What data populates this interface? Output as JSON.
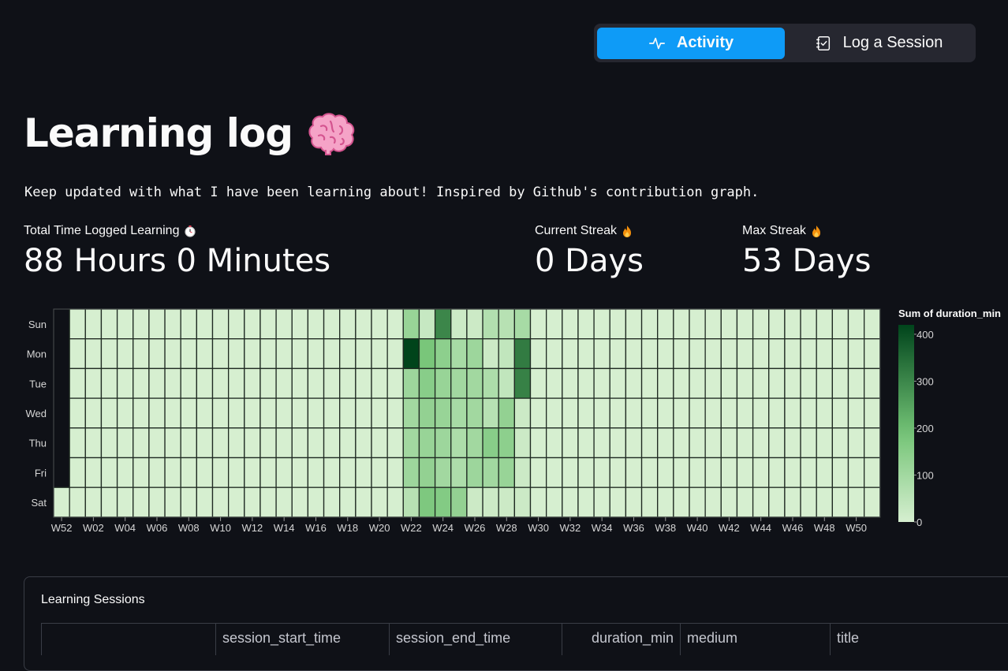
{
  "nav": {
    "items": [
      {
        "label": "Activity",
        "icon": "activity-icon",
        "active": true
      },
      {
        "label": "Log a Session",
        "icon": "checklist-icon",
        "active": false
      }
    ],
    "accent": "#0e9bf7"
  },
  "page": {
    "title": "Learning log",
    "title_icon": "brain-icon",
    "subtitle": "Keep updated with what I have been learning about! Inspired by Github's contribution graph."
  },
  "metrics": [
    {
      "label": "Total Time Logged Learning",
      "icon": "stopwatch-icon",
      "value": "88 Hours 0 Minutes"
    },
    {
      "label": "Current Streak",
      "icon": "fire-icon",
      "value": "0 Days"
    },
    {
      "label": "Max Streak",
      "icon": "fire-icon",
      "value": "53 Days"
    }
  ],
  "chart_data": {
    "type": "heatmap",
    "days": [
      "Sun",
      "Mon",
      "Tue",
      "Wed",
      "Thu",
      "Fri",
      "Sat"
    ],
    "week_tick_labels": [
      "W52",
      "W02",
      "W04",
      "W06",
      "W08",
      "W10",
      "W12",
      "W14",
      "W16",
      "W18",
      "W20",
      "W22",
      "W24",
      "W26",
      "W28",
      "W30",
      "W32",
      "W34",
      "W36",
      "W38",
      "W40",
      "W42",
      "W44",
      "W46",
      "W48",
      "W50"
    ],
    "weeks": [
      "W52",
      "W01",
      "W02",
      "W03",
      "W04",
      "W05",
      "W06",
      "W07",
      "W08",
      "W09",
      "W10",
      "W11",
      "W12",
      "W13",
      "W14",
      "W15",
      "W16",
      "W17",
      "W18",
      "W19",
      "W20",
      "W21",
      "W22",
      "W23",
      "W24",
      "W25",
      "W26",
      "W27",
      "W28",
      "W29",
      "W30",
      "W31",
      "W32",
      "W33",
      "W34",
      "W35",
      "W36",
      "W37",
      "W38",
      "W39",
      "W40",
      "W41",
      "W42",
      "W43",
      "W44",
      "W45",
      "W46",
      "W47",
      "W48",
      "W49",
      "W50",
      "W51"
    ],
    "colorbar_title": "Sum of duration_min",
    "colorbar_ticks": [
      0,
      100,
      200,
      300,
      400
    ],
    "zmin": 0,
    "zmax": 420,
    "color_low": "#d6efd0",
    "color_high": "#00441b",
    "missing": [
      {
        "week": "W52",
        "day": "Sun"
      },
      {
        "week": "W52",
        "day": "Mon"
      },
      {
        "week": "W52",
        "day": "Tue"
      },
      {
        "week": "W52",
        "day": "Wed"
      },
      {
        "week": "W52",
        "day": "Thu"
      },
      {
        "week": "W52",
        "day": "Fri"
      }
    ],
    "values": [
      {
        "week": "W22",
        "day": "Sun",
        "value": 120
      },
      {
        "week": "W22",
        "day": "Mon",
        "value": 420
      },
      {
        "week": "W22",
        "day": "Tue",
        "value": 110
      },
      {
        "week": "W22",
        "day": "Wed",
        "value": 100
      },
      {
        "week": "W22",
        "day": "Thu",
        "value": 100
      },
      {
        "week": "W22",
        "day": "Fri",
        "value": 110
      },
      {
        "week": "W22",
        "day": "Sat",
        "value": 60
      },
      {
        "week": "W23",
        "day": "Sun",
        "value": 30
      },
      {
        "week": "W23",
        "day": "Mon",
        "value": 180
      },
      {
        "week": "W23",
        "day": "Tue",
        "value": 150
      },
      {
        "week": "W23",
        "day": "Wed",
        "value": 130
      },
      {
        "week": "W23",
        "day": "Thu",
        "value": 120
      },
      {
        "week": "W23",
        "day": "Fri",
        "value": 130
      },
      {
        "week": "W23",
        "day": "Sat",
        "value": 170
      },
      {
        "week": "W24",
        "day": "Sun",
        "value": 300
      },
      {
        "week": "W24",
        "day": "Mon",
        "value": 140
      },
      {
        "week": "W24",
        "day": "Tue",
        "value": 120
      },
      {
        "week": "W24",
        "day": "Wed",
        "value": 120
      },
      {
        "week": "W24",
        "day": "Thu",
        "value": 110
      },
      {
        "week": "W24",
        "day": "Fri",
        "value": 100
      },
      {
        "week": "W24",
        "day": "Sat",
        "value": 160
      },
      {
        "week": "W25",
        "day": "Sun",
        "value": 20
      },
      {
        "week": "W25",
        "day": "Mon",
        "value": 90
      },
      {
        "week": "W25",
        "day": "Tue",
        "value": 100
      },
      {
        "week": "W25",
        "day": "Wed",
        "value": 90
      },
      {
        "week": "W25",
        "day": "Thu",
        "value": 80
      },
      {
        "week": "W25",
        "day": "Fri",
        "value": 80
      },
      {
        "week": "W25",
        "day": "Sat",
        "value": 130
      },
      {
        "week": "W26",
        "day": "Sun",
        "value": 20
      },
      {
        "week": "W26",
        "day": "Mon",
        "value": 110
      },
      {
        "week": "W26",
        "day": "Tue",
        "value": 100
      },
      {
        "week": "W26",
        "day": "Wed",
        "value": 100
      },
      {
        "week": "W26",
        "day": "Thu",
        "value": 100
      },
      {
        "week": "W26",
        "day": "Fri",
        "value": 110
      },
      {
        "week": "W26",
        "day": "Sat",
        "value": 20
      },
      {
        "week": "W27",
        "day": "Sun",
        "value": 70
      },
      {
        "week": "W27",
        "day": "Mon",
        "value": 20
      },
      {
        "week": "W27",
        "day": "Tue",
        "value": 80
      },
      {
        "week": "W27",
        "day": "Wed",
        "value": 60
      },
      {
        "week": "W27",
        "day": "Thu",
        "value": 150
      },
      {
        "week": "W27",
        "day": "Fri",
        "value": 100
      },
      {
        "week": "W27",
        "day": "Sat",
        "value": 20
      },
      {
        "week": "W28",
        "day": "Sun",
        "value": 60
      },
      {
        "week": "W28",
        "day": "Mon",
        "value": 40
      },
      {
        "week": "W28",
        "day": "Tue",
        "value": 40
      },
      {
        "week": "W28",
        "day": "Wed",
        "value": 130
      },
      {
        "week": "W28",
        "day": "Thu",
        "value": 140
      },
      {
        "week": "W28",
        "day": "Fri",
        "value": 120
      },
      {
        "week": "W28",
        "day": "Sat",
        "value": 20
      },
      {
        "week": "W29",
        "day": "Sun",
        "value": 90
      },
      {
        "week": "W29",
        "day": "Mon",
        "value": 320
      },
      {
        "week": "W29",
        "day": "Tue",
        "value": 310
      },
      {
        "week": "W29",
        "day": "Wed",
        "value": 20
      },
      {
        "week": "W29",
        "day": "Thu",
        "value": 20
      },
      {
        "week": "W29",
        "day": "Fri",
        "value": 20
      },
      {
        "week": "W29",
        "day": "Sat",
        "value": 20
      }
    ]
  },
  "sessions": {
    "title": "Learning Sessions",
    "columns": [
      "",
      "session_start_time",
      "session_end_time",
      "duration_min",
      "medium",
      "title"
    ]
  }
}
